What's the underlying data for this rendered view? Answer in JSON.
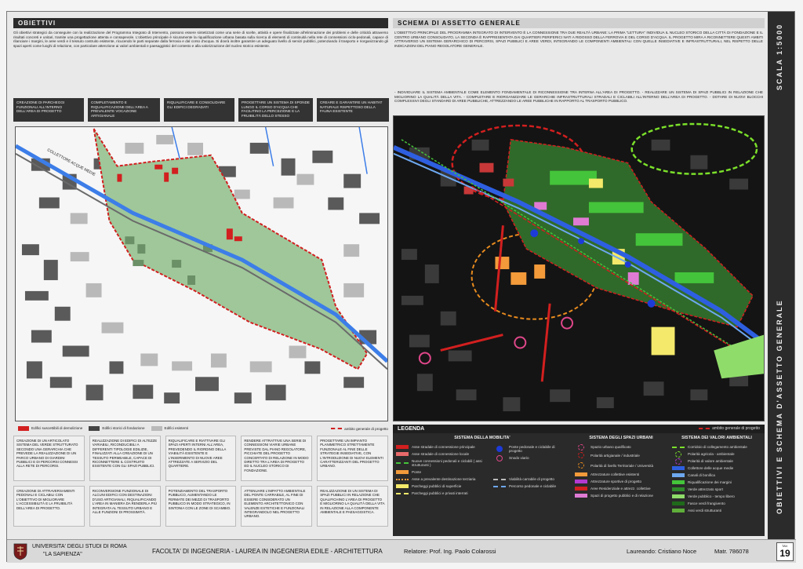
{
  "left_panel": {
    "title": "OBIETTIVI",
    "intro": "Gli obiettivi strategici da conseguire con la realizzazione del Programma Integrato di Intervento, possono essere sintetizzati come una serie di scelte, attività e opere finalizzate all'eliminazione dei problemi e delle criticità attraverso risultati concreti e unitari, tramite una progettazione attenta e consapevole. L'obiettivo principale è sicuramente la riqualificazione urbana basata sulla ricerca di elementi di continuità nella rete di connessioni ciclo-pedonali, capace di rilanciare i margini, le aree verdi e il tessuto costruito esistente, ricucendo le parti separate dalla ferrovia e dal corso d'acqua. Si dovrà inoltre garantire un adeguato livello di servizi pubblici, potenziando il trasporto e riorganizzando gli spazi aperti come luoghi di relazione, con particolare attenzione ai valori ambientali e paesaggistici del contesto e alla valorizzazione del nucleo storico esistente.",
    "goals": [
      "CREAZIONE DI PARCHEGGI FUNZIONALI ALL'INTERNO DELL'AREA DI PROGETTO",
      "COMPLETAMENTO E RIQUALIFICAZIONE DELL'AREA A PREVALENTE VOCAZIONE ARTIGIANALE",
      "RIQUALIFICARE E CONSOLIDARE GLI EDIFICI DEGRADATI",
      "PROGETTARE UN SISTEMA DI SPONDE LUNGO IL CORSO D'ACQUA CHE FACILITINO LA PERCEZIONE E LA FRUIBILITÀ DELLO STESSO",
      "CREARE E GARANTIRE UN HABITAT NATURALE RISPETTOSO DELLA FAUNA ESISTENTE"
    ],
    "map_label": "COLLETTORE ACQUE MEDIE",
    "legend": {
      "demolition": "Edifici suscettibili di demolizione",
      "foundation": "Edifici storici di fondazione",
      "existing": "Edifici esistenti",
      "perimeter": "ambito generale di progetto"
    },
    "bottom_cells": [
      "CREAZIONE DI UN ARTICOLATO SISTEMA DEL VERDE STRUTTURATO SECONDO UNA GERARCHIA CHE PREVEDE LA REALIZZAZIONE DI UN PARCO URBANO DI GIARDINI PUBBLICI E DI PERCORSI CONNESSI ALLA RETE DI PERCORSI.",
      "REALIZZAZIONE DI EDIFICI DI ALTEZZE VARIABILI, RICONDUCIBILI A DIFFERENTI TIPOLOGIE EDILIZIE, FINALIZZATI ALLA CREAZIONE DI UN TESSUTO PERMEABILE, CAPACE DI RICONNETTERE IL COSTRUITO ESISTENTE CON GLI SPAZI PUBBLICI.",
      "RIQUALIFICARE E RIATTIVARE GLI SPAZI APERTI INTERNI ALL'AREA, PREVEDENDO IL RIORDINO DELLA VIABILITÀ ESISTENTE E L'INSERIMENTO DI NUOVE AREE ATTREZZATE A SERVIZIO DEL QUARTIERE.",
      "RENDERE ATTRATTIVE UNA SERIE DI CONNESSIONI VIARIE URBANE PREVISTE DAL PIANO REGOLATORE, PICCHIATE DEL PROGETTO CONCERTATO DI RELAZIONE IN MODO DIRETTO TRA L'AREA DI PROGETTO ED IL NUCLEO STORICO DI FONDAZIONE.",
      "PROGETTARE UN IMPIANTO PLANIMETRICO STRETTAMENTE FUNZIONALE AL FINE DELLE STRATEGIE INSEDIATIVE, CON L'INTRODUZIONE DI NUOVI ELEMENTI CARATTERIZZANTI DEL PROGETTO URBANO.",
      "CREAZIONE DI ATTRAVERSAMENTI PEDONALI E CICLABILI CON L'OBIETTIVO DI MIGLIORARE L'ACCESSIBILITÀ E LA FRUIBILITÀ DELL'AREA DI PROGETTO.",
      "RICONVERSIONE FUNZIONALE DI ALCUNI EDIFICI CON DESTINAZIONI D'USO ARTIGIANALI, RIQUALIFICANDO L'AREA IN MANIERA DA RENDERLA PIÙ INTEGRATA AL TESSUTO URBANO E ALLE FUNZIONI DI PROSSIMITÀ.",
      "POTENZIAMENTO DEL TRASPORTO PUBBLICO, AUMENTANDO LE FERMATE DEI MEZZI DI TRASPORTO PUBBLICO IN MODO STRATEGICO, IN SINTONIA CON LE ZONE DI SCAMBIO.",
      "ATTENUARE L'IMPATTO AMBIENTALE DEL PONTE CARRABILE, AL FINE DI ESSERE CONSIDERATO UN ELEMENTO ARCHITETTONICO CON VALENZE ESTETICHE E FUNZIONALI INTEGRANDOLO NEL PROGETTO URBANO.",
      "REALIZZAZIONE DI UN SISTEMA DI SPAZI PUBBLICI IN RELAZIONE CHE QUALIFICHINO L'AREA DI PROGETTO E MIGLIORINO LA QUALITÀ DELLA VITA IN RELAZIONE ALLA COMPONENTE AMBIENTALE E PAESAGGISTICA."
    ]
  },
  "right_panel": {
    "title": "SCHEMA DI ASSETTO GENERALE",
    "intro": "L'OBIETTIVO PRINCIPALE DEL PROGRAMMA INTEGRATO DI INTERVENTO È LA CONNESSIONE TRA DUE REALTÀ URBANE: LA PRIMA \"LETTURA\" INDIVIDUA IL NUCLEO STORICO DELLA CITTÀ DI FONDAZIONE E IL CENTRO URBANO CONSOLIDATO, LA SECONDA È RAPPRESENTATA DAI QUARTIERI PERIFERICI NATI A RIDOSSO DELLA FERROVIA E DEL CORSO D'ACQUA. IL PROGETTO MIRA A RICONNETTERE QUESTI AMBITI ATTRAVERSO UN SISTEMA GERARCHICO DI PERCORSI, SPAZI PUBBLICI E AREE VERDI, INTEGRANDO LE COMPONENTI AMBIENTALI CON QUELLE INSEDIATIVE E INFRASTRUTTURALI, NEL RISPETTO DELLE INDICAZIONI DEL PIANO REGOLATORE GENERALE.",
    "bullets": "- INDIVIDUARE IL SISTEMA AMBIENTALE COME ELEMENTO FONDAMENTALE DI RICONNESSIONE TRA INTERNA ALL'AREA DI PROGETTO. - REALIZZARE UN SISTEMA DI SPAZI PUBBLICI IN RELAZIONE CHE MIGLIORINO LA QUALITÀ DELLA VITA. - COMPLETARE E RIORGANIZZARE LE GERARCHIE INFRASTRUTTURALI STRADALI E CICLABILI ALL'INTERNO DELL'AREA DI PROGETTO. - DOTARE DI NUOVI BLOCCHI COMPLESSIVI DEGLI STANDARD DI AREE PUBBLICHE, ATTREZZANDO LE AREE PUBBLICHE IN RAPPORTO AL TRASPORTO PUBBLICO.",
    "legend": {
      "title": "LEGENDA",
      "mobility": {
        "title": "SISTEMA DELLA MOBILITA'",
        "items": [
          "Asse stradale di connessione principale",
          "Asse stradale di connessione locale",
          "Nuove connessioni pedonali e ciclabili ( assi strutturanti )",
          "Ponte",
          "Asse a prevalente destinazione terziaria",
          "Parcheggi pubblici di superficie",
          "Parcheggi pubblici e privati interrati"
        ],
        "items_b": [
          "Ponte pedonale e ciclabile di progetto",
          "Snodo viario",
          "Viabilità carrabile di progetto",
          "Percorso pedonale e ciclabile"
        ]
      },
      "urban": {
        "title": "SISTEMA DEGLI SPAZI URBANI",
        "items": [
          "Spazio urbano qualificato",
          "Polarità artigianale / industriale",
          "Polarità di livello Territoriale / Università",
          "Attrezzature collettive esistenti",
          "Attrezzature sportive di progetto",
          "Aree Residenziale e attrezz. collettive",
          "Spazi di progetto pubblici e di relazione"
        ]
      },
      "env": {
        "title": "SISTEMA DEI VALORI AMBIENTALI",
        "items": [
          "Corridoio di collegamento ambientale",
          "Polarità agricola - ambientale",
          "Polarità di valore ambientale",
          "Collettore delle acque medie",
          "Canali di bonifica",
          "Riqualificazione dei margini",
          "Verde attrezzato sport",
          "Verde pubblico - tempo libero",
          "Fasce verdi frangivento",
          "Assi verdi strutturanti"
        ]
      },
      "perimeter": "ambito generale di progetto"
    }
  },
  "side": {
    "scale": "SCALA 1:5000",
    "title": "OBIETTIVI E SCHEMA D'ASSETTO GENERALE"
  },
  "footer": {
    "university": "UNIVERSITA' DEGLI STUDI DI ROMA",
    "university2": "\"LA SAPIENZA\"",
    "faculty": "FACOLTA' DI INGEGNERIA  -  LAUREA IN INGEGNERIA EDILE - ARCHITETTURA",
    "advisor": "Relatore: Prof. Ing. Paolo Colarossi",
    "student": "Laureando: Cristiano Noce",
    "matr": "Matr. 786078",
    "tav_label": "TAV.",
    "tav_number": "19"
  },
  "colors": {
    "dark_bar": "#2b2b2b",
    "project_area": "#9fc79a",
    "perimeter": "#d21f1f",
    "water": "#3c7de8",
    "rail_blue": "#2e5fe0",
    "green_bright": "#44c43a"
  }
}
